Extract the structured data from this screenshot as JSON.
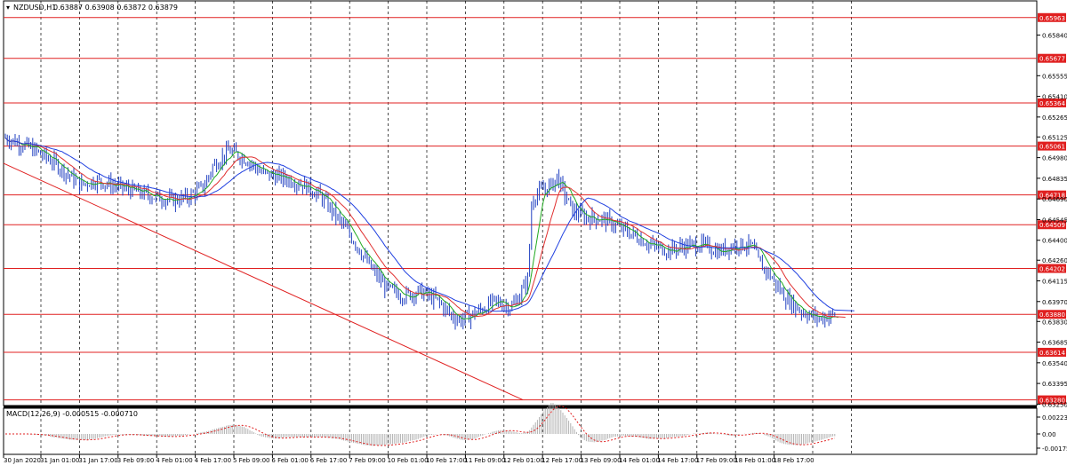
{
  "header": {
    "symbol_label": "NZDUSD,H1",
    "ohlc_text": "0.63887 0.63908 0.63872 0.63879"
  },
  "macd": {
    "label": "MACD(12,26,9) -0.000515 -0.000710"
  },
  "colors": {
    "candle": "#1f3fc0",
    "level_line": "#e02020",
    "ma_fast": "#22aa22",
    "ma_mid": "#e03030",
    "ma_slow": "#2040e0",
    "grid": "#000000",
    "macd_hist": "#b0b0b0",
    "macd_signal": "#e02020"
  },
  "chart_data": {
    "type": "line",
    "title": "NZDUSD,H1",
    "ylim": [
      0.6324,
      0.6608
    ],
    "price_ticks": [
      "0.65840",
      "0.65555",
      "0.65410",
      "0.65265",
      "0.65125",
      "0.64980",
      "0.64835",
      "0.64690",
      "0.64545",
      "0.64400",
      "0.64260",
      "0.64115",
      "0.63970",
      "0.63830",
      "0.63685",
      "0.63540",
      "0.63395",
      "0.63250"
    ],
    "levels": [
      "0.65963",
      "0.65677",
      "0.65364",
      "0.65061",
      "0.64718",
      "0.64509",
      "0.64202",
      "0.63880",
      "0.63614",
      "0.63280"
    ],
    "time_labels": [
      "30 Jan 2020",
      "31 Jan 01:00",
      "31 Jan 17:00",
      "3 Feb 09:00",
      "4 Feb 01:00",
      "4 Feb 17:00",
      "5 Feb 09:00",
      "6 Feb 01:00",
      "6 Feb 17:00",
      "7 Feb 09:00",
      "10 Feb 01:00",
      "10 Feb 17:00",
      "11 Feb 09:00",
      "12 Feb 01:00",
      "12 Feb 17:00",
      "13 Feb 09:00",
      "14 Feb 01:00",
      "14 Feb 17:00",
      "17 Feb 09:00",
      "18 Feb 01:00",
      "18 Feb 17:00"
    ],
    "price_path": [
      [
        0,
        0.6512
      ],
      [
        0.03,
        0.6505
      ],
      [
        0.06,
        0.6494
      ],
      [
        0.09,
        0.6479
      ],
      [
        0.11,
        0.6482
      ],
      [
        0.14,
        0.6477
      ],
      [
        0.17,
        0.6472
      ],
      [
        0.2,
        0.6468
      ],
      [
        0.22,
        0.647
      ],
      [
        0.24,
        0.6478
      ],
      [
        0.25,
        0.6492
      ],
      [
        0.27,
        0.6503
      ],
      [
        0.29,
        0.6497
      ],
      [
        0.31,
        0.6487
      ],
      [
        0.34,
        0.6483
      ],
      [
        0.36,
        0.6479
      ],
      [
        0.38,
        0.6471
      ],
      [
        0.4,
        0.6456
      ],
      [
        0.42,
        0.644
      ],
      [
        0.44,
        0.6421
      ],
      [
        0.46,
        0.6406
      ],
      [
        0.48,
        0.6401
      ],
      [
        0.5,
        0.6404
      ],
      [
        0.52,
        0.6398
      ],
      [
        0.53,
        0.6392
      ],
      [
        0.54,
        0.6386
      ],
      [
        0.55,
        0.6384
      ],
      [
        0.57,
        0.639
      ],
      [
        0.59,
        0.6397
      ],
      [
        0.61,
        0.6393
      ],
      [
        0.62,
        0.6401
      ],
      [
        0.63,
        0.6413
      ],
      [
        0.635,
        0.647
      ],
      [
        0.65,
        0.6476
      ],
      [
        0.66,
        0.6479
      ],
      [
        0.665,
        0.6485
      ],
      [
        0.675,
        0.6471
      ],
      [
        0.685,
        0.646
      ],
      [
        0.7,
        0.6456
      ],
      [
        0.72,
        0.6455
      ],
      [
        0.74,
        0.6449
      ],
      [
        0.76,
        0.6443
      ],
      [
        0.78,
        0.6436
      ],
      [
        0.8,
        0.6433
      ],
      [
        0.82,
        0.6436
      ],
      [
        0.84,
        0.6437
      ],
      [
        0.86,
        0.6432
      ],
      [
        0.88,
        0.6437
      ],
      [
        0.9,
        0.6436
      ],
      [
        0.91,
        0.6423
      ],
      [
        0.92,
        0.6417
      ],
      [
        0.94,
        0.64
      ],
      [
        0.96,
        0.639
      ],
      [
        0.98,
        0.6385
      ],
      [
        1,
        0.6388
      ]
    ],
    "series": [
      {
        "values": "fast moving average"
      },
      {
        "values": "medium moving average"
      },
      {
        "values": "slow moving average"
      }
    ],
    "trendline": {
      "from_price": 0.6494,
      "to_price": 0.6328
    },
    "macd_ticks": [
      "0.002239",
      "0.00",
      "-0.001752"
    ],
    "grid": true
  }
}
